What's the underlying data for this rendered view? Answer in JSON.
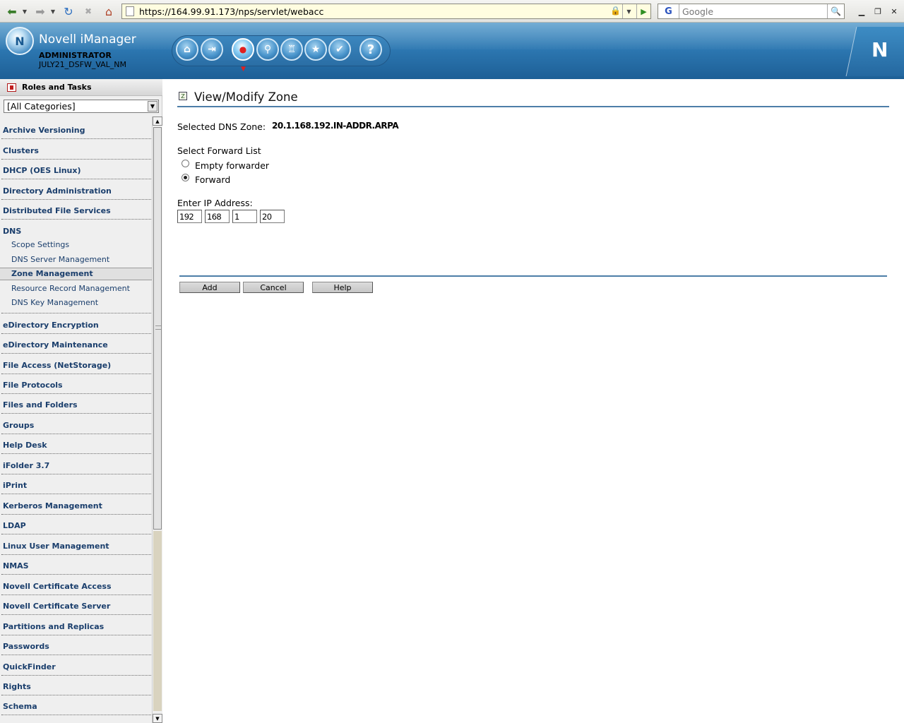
{
  "browser": {
    "url": "https://164.99.91.173/nps/servlet/webacc",
    "search_placeholder": "Google",
    "search_engine_icon": "G"
  },
  "header": {
    "app_title": "Novell iManager",
    "user": "ADMINISTRATOR",
    "tree": "JULY21_DSFW_VAL_NM",
    "logo_letter": "N",
    "brand_letter": "N",
    "toolbar_icons": [
      "home-icon",
      "exit-icon",
      "roles-tasks-icon",
      "view-objects-icon",
      "configure-icon",
      "favorites-icon",
      "preferences-icon",
      "help-icon"
    ],
    "help_glyph": "?"
  },
  "left_panel": {
    "title": "Roles and Tasks",
    "category": "[All Categories]",
    "categories": [
      {
        "label": "Archive Versioning"
      },
      {
        "label": "Clusters"
      },
      {
        "label": "DHCP (OES Linux)"
      },
      {
        "label": "Directory Administration"
      },
      {
        "label": "Distributed File Services"
      },
      {
        "label": "DNS"
      },
      {
        "label": "eDirectory Encryption"
      },
      {
        "label": "eDirectory Maintenance"
      },
      {
        "label": "File Access (NetStorage)"
      },
      {
        "label": "File Protocols"
      },
      {
        "label": "Files and Folders"
      },
      {
        "label": "Groups"
      },
      {
        "label": "Help Desk"
      },
      {
        "label": "iFolder 3.7"
      },
      {
        "label": "iPrint"
      },
      {
        "label": "Kerberos Management"
      },
      {
        "label": "LDAP"
      },
      {
        "label": "Linux User Management"
      },
      {
        "label": "NMAS"
      },
      {
        "label": "Novell Certificate Access"
      },
      {
        "label": "Novell Certificate Server"
      },
      {
        "label": "Partitions and Replicas"
      },
      {
        "label": "Passwords"
      },
      {
        "label": "QuickFinder"
      },
      {
        "label": "Rights"
      },
      {
        "label": "Schema"
      }
    ],
    "dns_tasks": [
      "Scope Settings",
      "DNS Server Management",
      "Zone Management",
      "Resource Record Management",
      "DNS Key Management"
    ],
    "selected_task": "Zone Management"
  },
  "main": {
    "title": "View/Modify Zone",
    "zone_label": "Selected DNS Zone:",
    "zone_value": "20.1.168.192.IN-ADDR.ARPA",
    "forward_title": "Select Forward List",
    "options": [
      {
        "label": "Empty forwarder",
        "checked": false
      },
      {
        "label": "Forward",
        "checked": true
      }
    ],
    "ip_label": "Enter IP Address:",
    "ip_octets": [
      "192",
      "168",
      "1",
      "20"
    ],
    "buttons": {
      "add": "Add",
      "cancel": "Cancel",
      "help": "Help"
    }
  }
}
